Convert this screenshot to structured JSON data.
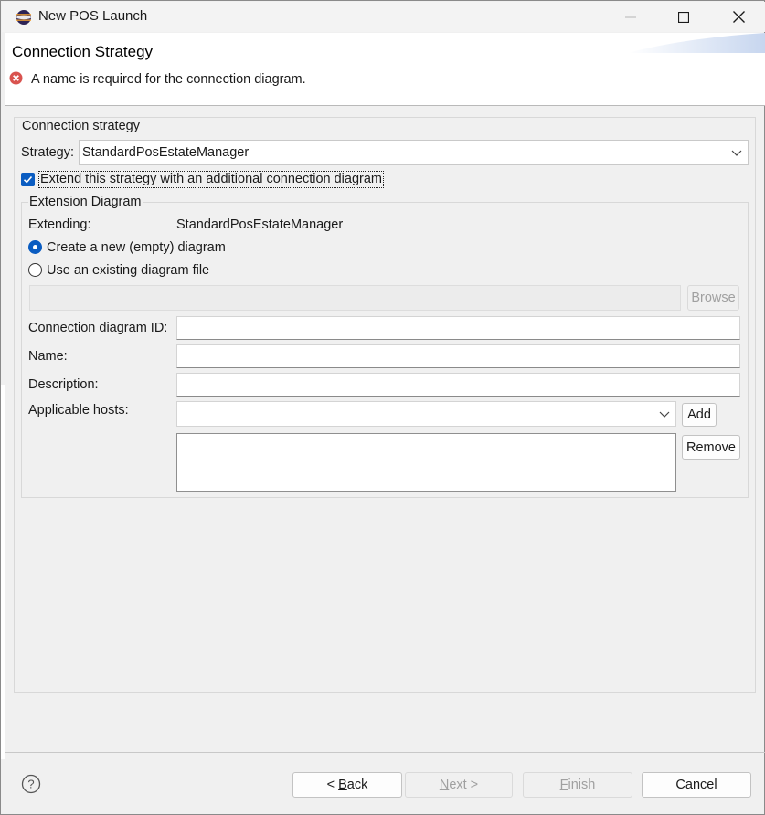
{
  "window": {
    "title": "New POS Launch"
  },
  "header": {
    "title": "Connection Strategy",
    "message": "A name is required for the connection diagram."
  },
  "connection_group": {
    "title": "Connection strategy",
    "strategy_label": "Strategy:",
    "strategy_value": "StandardPosEstateManager",
    "extend_checkbox_label": "Extend this strategy with an additional connection diagram",
    "extend_checked": true
  },
  "extension_group": {
    "title": "Extension Diagram",
    "extending_label": "Extending:",
    "extending_value": "StandardPosEstateManager",
    "radio_new_label": "Create a new (empty) diagram",
    "radio_existing_label": "Use an existing diagram file",
    "selected_radio": "new",
    "file_path_value": "",
    "browse_label": "Browse",
    "diagram_id_label": "Connection diagram ID:",
    "diagram_id_value": "",
    "name_label": "Name:",
    "name_value": "",
    "description_label": "Description:",
    "description_value": "",
    "hosts_label": "Applicable hosts:",
    "hosts_value": "",
    "add_label": "Add",
    "remove_label": "Remove"
  },
  "footer": {
    "back_prefix": "< ",
    "back_mnemonic": "B",
    "back_rest": "ack",
    "next_mnemonic": "N",
    "next_rest": "ext >",
    "finish_mnemonic": "F",
    "finish_rest": "inish",
    "cancel_label": "Cancel"
  },
  "colors": {
    "accent": "#0a5cc1",
    "error": "#d9534f",
    "window_bg": "#f0f0f0"
  },
  "icons": [
    "app-icon",
    "minimize-icon",
    "maximize-icon",
    "close-icon",
    "error-icon",
    "chevron-down-icon",
    "check-icon",
    "help-icon"
  ]
}
